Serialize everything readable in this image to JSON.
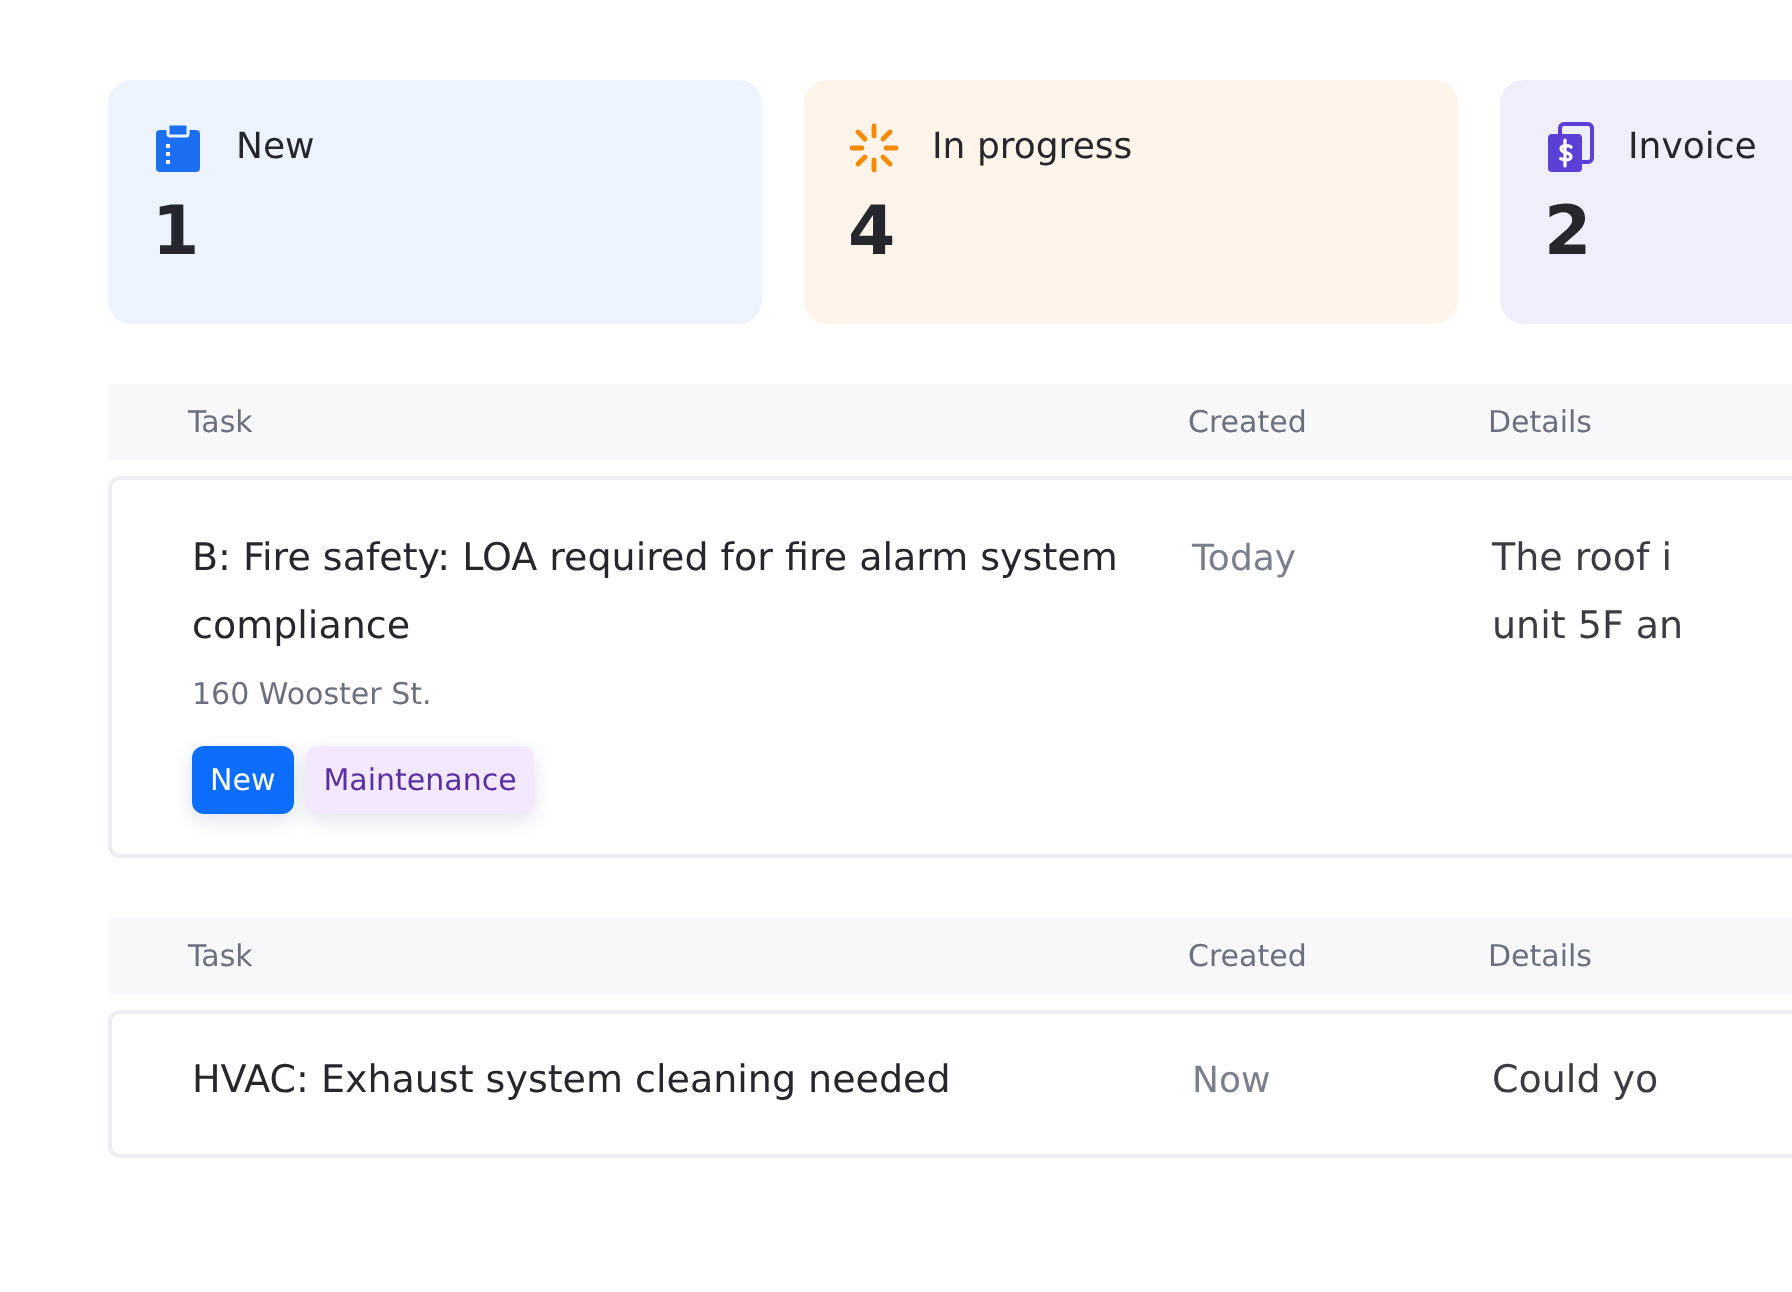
{
  "summary_cards": [
    {
      "kind": "new",
      "label": "New",
      "count": "1"
    },
    {
      "kind": "progress",
      "label": "In progress",
      "count": "4"
    },
    {
      "kind": "invoice",
      "label": "Invoice",
      "count": "2"
    }
  ],
  "tables": [
    {
      "columns": [
        "Task",
        "Created",
        "Details"
      ],
      "rows": [
        {
          "title": "B: Fire safety: LOA required for fire alarm system compliance",
          "address": "160 Wooster St.",
          "tags": [
            {
              "kind": "status",
              "label": "New"
            },
            {
              "kind": "category",
              "label": "Maintenance"
            }
          ],
          "created": "Today",
          "details": [
            "The roof i",
            "unit 5F an"
          ]
        }
      ]
    },
    {
      "columns": [
        "Task",
        "Created",
        "Details"
      ],
      "rows": [
        {
          "title": "HVAC: Exhaust system cleaning needed",
          "created": "Now",
          "details": [
            "Could yo"
          ]
        }
      ]
    }
  ]
}
